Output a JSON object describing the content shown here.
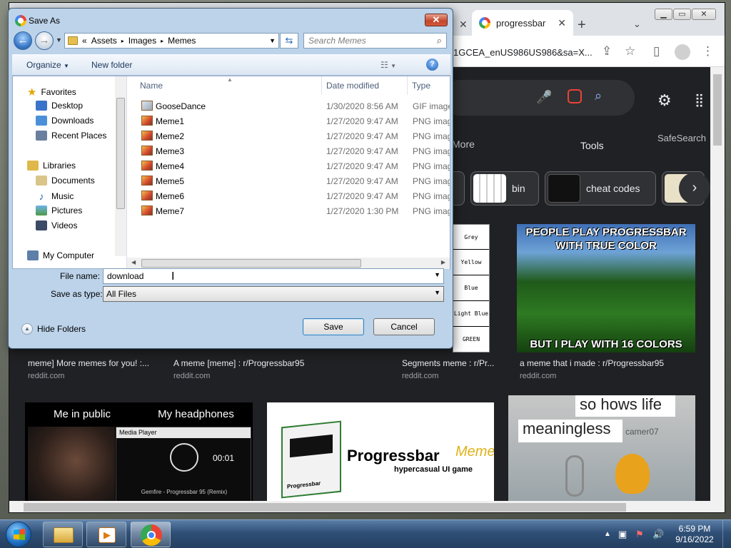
{
  "browser": {
    "tab_title": "progressbar",
    "url_fragment": "1GCEA_enUS986US986&sa=X...",
    "search": {
      "menu_more": "More",
      "menu_tools": "Tools",
      "menu_safesearch": "SafeSearch"
    },
    "chips": [
      {
        "label": "bin"
      },
      {
        "label": "cheat codes"
      }
    ],
    "results_row1": [
      {
        "caption": "meme] More memes for you! :...",
        "source": "reddit.com"
      },
      {
        "caption": "A meme [meme] : r/Progressbar95",
        "source": "reddit.com"
      },
      {
        "caption": "Segments meme : r/Pr...",
        "source": "reddit.com"
      },
      {
        "caption": "a meme that i made : r/Progressbar95",
        "source": "reddit.com"
      }
    ],
    "colors_list": [
      "Grey",
      "Yellow",
      "Blue",
      "Light Blue",
      "GREEN"
    ],
    "meme_16colors": {
      "top": "PEOPLE PLAY PROGRESSBAR WITH TRUE COLOR",
      "bottom": "BUT I PLAY WITH 16 COLORS"
    },
    "meme_public": {
      "left": "Me in public",
      "right": "My headphones",
      "player_title": "Media Player",
      "time": "00:01",
      "track": "Gemfire - Progressbar 95 (Remix)"
    },
    "logo": {
      "brand": "Progressbar",
      "script": "Meme",
      "tagline": "hypercasual UI game",
      "box_label": "Progressbar"
    },
    "meme_clippy": {
      "line1": "so hows life",
      "line2": "meaningless",
      "watermark": "camer07"
    }
  },
  "dialog": {
    "title": "Save As",
    "breadcrumb": [
      "«",
      "Assets",
      "▸",
      "Images",
      "▸",
      "Memes"
    ],
    "search_placeholder": "Search Memes",
    "organize": "Organize",
    "new_folder": "New folder",
    "nav": {
      "favorites": "Favorites",
      "desktop": "Desktop",
      "downloads": "Downloads",
      "recent": "Recent Places",
      "libraries": "Libraries",
      "documents": "Documents",
      "music": "Music",
      "pictures": "Pictures",
      "videos": "Videos",
      "computer": "My Computer"
    },
    "columns": {
      "name": "Name",
      "date": "Date modified",
      "type": "Type"
    },
    "files": [
      {
        "name": "GooseDance",
        "date": "1/30/2020 8:56 AM",
        "type": "GIF image"
      },
      {
        "name": "Meme1",
        "date": "1/27/2020 9:47 AM",
        "type": "PNG image"
      },
      {
        "name": "Meme2",
        "date": "1/27/2020 9:47 AM",
        "type": "PNG image"
      },
      {
        "name": "Meme3",
        "date": "1/27/2020 9:47 AM",
        "type": "PNG image"
      },
      {
        "name": "Meme4",
        "date": "1/27/2020 9:47 AM",
        "type": "PNG image"
      },
      {
        "name": "Meme5",
        "date": "1/27/2020 9:47 AM",
        "type": "PNG image"
      },
      {
        "name": "Meme6",
        "date": "1/27/2020 9:47 AM",
        "type": "PNG image"
      },
      {
        "name": "Meme7",
        "date": "1/27/2020 1:30 PM",
        "type": "PNG image"
      }
    ],
    "file_name_label": "File name:",
    "file_name_value": "download",
    "save_type_label": "Save as type:",
    "save_type_value": "All Files",
    "save": "Save",
    "cancel": "Cancel",
    "hide_folders": "Hide Folders"
  },
  "taskbar": {
    "time": "6:59 PM",
    "date": "9/16/2022"
  }
}
